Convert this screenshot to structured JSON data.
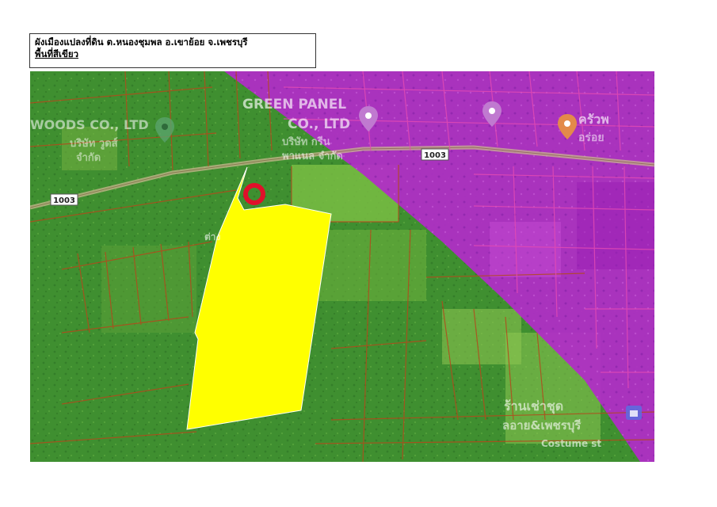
{
  "header": {
    "title": "ผังเมืองแปลงที่ดิน  ต.หนองชุมพล อ.เขาย้อย จ.เพชรบุรี",
    "subtitle": "พื้นที่สีเขียว"
  },
  "map": {
    "labels": {
      "woods": "WOODS CO., LTD",
      "woods_thai": "บริษัท วูดส์",
      "woods_thai2": "จำกัด",
      "green_panel_1": "GREEN PANEL",
      "green_panel_2": "CO., LTD",
      "green_panel_thai": "บริษัท กรีน",
      "green_panel_thai2": "พาแนล จำกัด",
      "road_1003_left": "1003",
      "road_1003_right": "1003",
      "restaurant_thai": "ครัวพ",
      "restaurant_thai2": "อร่อย",
      "partial_label": "ต่าง",
      "shop_thai": "ร้านเช่าชุด",
      "shop_thai2": "ลอาย&เพชรบุรี",
      "shop_en": "Costume st"
    },
    "colors": {
      "green_zone": "#3d8f2f",
      "purple_zone": "#b028c8",
      "plot_highlight": "#ffff00",
      "parcel_lines": "#b04a1e",
      "marker": "#e0102a"
    },
    "icons": [
      "location-pin-icon",
      "plot-marker-icon"
    ]
  }
}
